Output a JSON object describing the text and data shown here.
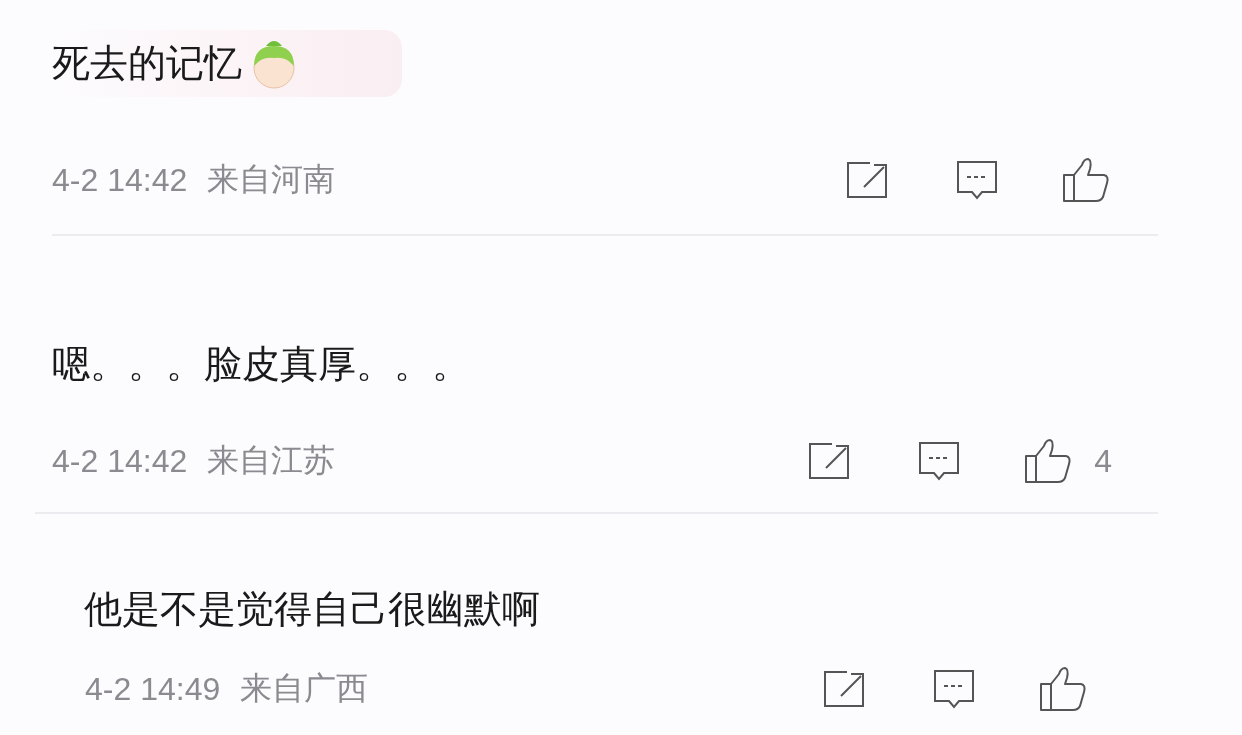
{
  "comments": [
    {
      "text": "死去的记忆",
      "has_sticker": true,
      "time": "4-2 14:42",
      "location": "来自河南"
    },
    {
      "text": "嗯。。。脸皮真厚。。。",
      "has_sticker": false,
      "time": "4-2 14:42",
      "location": "来自江苏",
      "likes": "4"
    },
    {
      "text": "他是不是觉得自己很幽默啊",
      "has_sticker": false,
      "time": "4-2 14:49",
      "location": "来自广西"
    }
  ]
}
